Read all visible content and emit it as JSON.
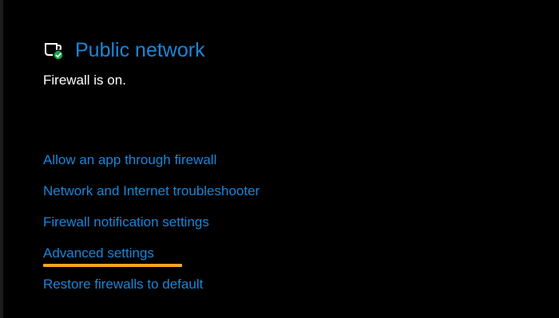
{
  "network": {
    "title": "Public network",
    "icon": "public-network-shield-icon",
    "status": "Firewall is on."
  },
  "links": [
    {
      "label": "Allow an app through firewall"
    },
    {
      "label": "Network and Internet troubleshooter"
    },
    {
      "label": "Firewall notification settings"
    },
    {
      "label": "Advanced settings"
    },
    {
      "label": "Restore firewalls to default"
    }
  ],
  "colors": {
    "background": "#000000",
    "accent": "#1a86d9",
    "text": "#ffffff",
    "highlight": "#f5a623",
    "status_ok": "#16a34a"
  }
}
